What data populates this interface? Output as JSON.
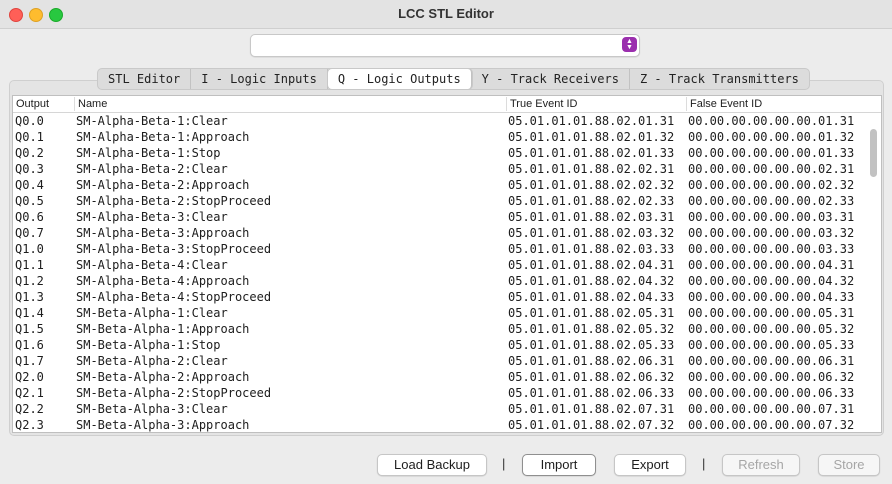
{
  "window": {
    "title": "LCC STL Editor"
  },
  "selector": {
    "value": ""
  },
  "tabs": [
    {
      "label": "STL Editor"
    },
    {
      "label": "I - Logic Inputs"
    },
    {
      "label": "Q - Logic Outputs"
    },
    {
      "label": "Y - Track Receivers"
    },
    {
      "label": "Z - Track Transmitters"
    }
  ],
  "active_tab": "Q - Logic Outputs",
  "table": {
    "columns": [
      "Output",
      "Name",
      "True Event ID",
      "False Event ID"
    ],
    "rows": [
      [
        "Q0.0",
        "SM-Alpha-Beta-1:Clear",
        "05.01.01.01.88.02.01.31",
        "00.00.00.00.00.00.01.31"
      ],
      [
        "Q0.1",
        "SM-Alpha-Beta-1:Approach",
        "05.01.01.01.88.02.01.32",
        "00.00.00.00.00.00.01.32"
      ],
      [
        "Q0.2",
        "SM-Alpha-Beta-1:Stop",
        "05.01.01.01.88.02.01.33",
        "00.00.00.00.00.00.01.33"
      ],
      [
        "Q0.3",
        "SM-Alpha-Beta-2:Clear",
        "05.01.01.01.88.02.02.31",
        "00.00.00.00.00.00.02.31"
      ],
      [
        "Q0.4",
        "SM-Alpha-Beta-2:Approach",
        "05.01.01.01.88.02.02.32",
        "00.00.00.00.00.00.02.32"
      ],
      [
        "Q0.5",
        "SM-Alpha-Beta-2:StopProceed",
        "05.01.01.01.88.02.02.33",
        "00.00.00.00.00.00.02.33"
      ],
      [
        "Q0.6",
        "SM-Alpha-Beta-3:Clear",
        "05.01.01.01.88.02.03.31",
        "00.00.00.00.00.00.03.31"
      ],
      [
        "Q0.7",
        "SM-Alpha-Beta-3:Approach",
        "05.01.01.01.88.02.03.32",
        "00.00.00.00.00.00.03.32"
      ],
      [
        "Q1.0",
        "SM-Alpha-Beta-3:StopProceed",
        "05.01.01.01.88.02.03.33",
        "00.00.00.00.00.00.03.33"
      ],
      [
        "Q1.1",
        "SM-Alpha-Beta-4:Clear",
        "05.01.01.01.88.02.04.31",
        "00.00.00.00.00.00.04.31"
      ],
      [
        "Q1.2",
        "SM-Alpha-Beta-4:Approach",
        "05.01.01.01.88.02.04.32",
        "00.00.00.00.00.00.04.32"
      ],
      [
        "Q1.3",
        "SM-Alpha-Beta-4:StopProceed",
        "05.01.01.01.88.02.04.33",
        "00.00.00.00.00.00.04.33"
      ],
      [
        "Q1.4",
        "SM-Beta-Alpha-1:Clear",
        "05.01.01.01.88.02.05.31",
        "00.00.00.00.00.00.05.31"
      ],
      [
        "Q1.5",
        "SM-Beta-Alpha-1:Approach",
        "05.01.01.01.88.02.05.32",
        "00.00.00.00.00.00.05.32"
      ],
      [
        "Q1.6",
        "SM-Beta-Alpha-1:Stop",
        "05.01.01.01.88.02.05.33",
        "00.00.00.00.00.00.05.33"
      ],
      [
        "Q1.7",
        "SM-Beta-Alpha-2:Clear",
        "05.01.01.01.88.02.06.31",
        "00.00.00.00.00.00.06.31"
      ],
      [
        "Q2.0",
        "SM-Beta-Alpha-2:Approach",
        "05.01.01.01.88.02.06.32",
        "00.00.00.00.00.00.06.32"
      ],
      [
        "Q2.1",
        "SM-Beta-Alpha-2:StopProceed",
        "05.01.01.01.88.02.06.33",
        "00.00.00.00.00.00.06.33"
      ],
      [
        "Q2.2",
        "SM-Beta-Alpha-3:Clear",
        "05.01.01.01.88.02.07.31",
        "00.00.00.00.00.00.07.31"
      ],
      [
        "Q2.3",
        "SM-Beta-Alpha-3:Approach",
        "05.01.01.01.88.02.07.32",
        "00.00.00.00.00.00.07.32"
      ]
    ]
  },
  "buttons": {
    "load_backup": "Load Backup",
    "import": "Import",
    "export": "Export",
    "refresh": "Refresh",
    "store": "Store",
    "separator": "|"
  },
  "icons": {
    "selector": "chevron-updown-icon",
    "close": "close-icon",
    "minimize": "minimize-icon",
    "maximize": "maximize-icon"
  },
  "colors": {
    "selector_accent": "#9b2fae",
    "close": "#ff5f57",
    "minimize": "#febc2e",
    "maximize": "#28c840"
  }
}
